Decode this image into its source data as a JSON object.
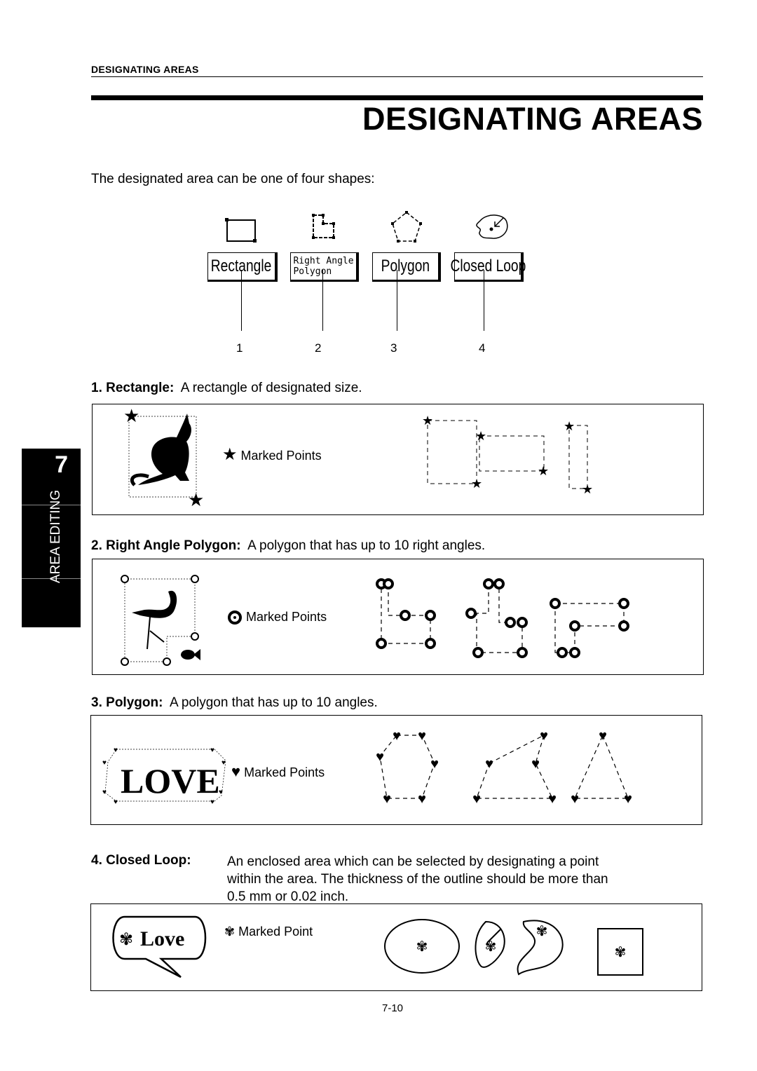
{
  "header": {
    "running_title": "DESIGNATING AREAS",
    "title": "DESIGNATING AREAS"
  },
  "intro": "The designated area can be one of four shapes:",
  "buttons": [
    {
      "label": "Rectangle",
      "number": "1"
    },
    {
      "label": "Right Angle Polygon",
      "line1": "Right Angle",
      "line2": "Polygon",
      "number": "2"
    },
    {
      "label": "Polygon",
      "number": "3"
    },
    {
      "label": "Closed Loop",
      "number": "4"
    }
  ],
  "sections": [
    {
      "num": "1.",
      "term": "Rectangle:",
      "desc": "A rectangle of designated size.",
      "marker_label": "Marked Points",
      "marker_icon": "star-icon"
    },
    {
      "num": "2.",
      "term": "Right Angle Polygon:",
      "desc": "A polygon that has up to 10 right angles.",
      "marker_label": "Marked Points",
      "marker_icon": "circle-dot-icon"
    },
    {
      "num": "3.",
      "term": "Polygon:",
      "desc": "A polygon that has up to 10 angles.",
      "marker_label": "Marked Points",
      "marker_icon": "heart-icon",
      "example_text": "LOVE"
    },
    {
      "num": "4.",
      "term": "Closed Loop:",
      "desc_lines": [
        "An enclosed area which can be selected by designating a point",
        "within the area.  The thickness of the outline should be more than",
        "0.5 mm or 0.02 inch."
      ],
      "marker_label": "Marked Point",
      "marker_icon": "flower-icon",
      "example_text": "Love"
    }
  ],
  "side_tab": {
    "number": "7",
    "label": "AREA EDITING"
  },
  "page_number": "7-10"
}
